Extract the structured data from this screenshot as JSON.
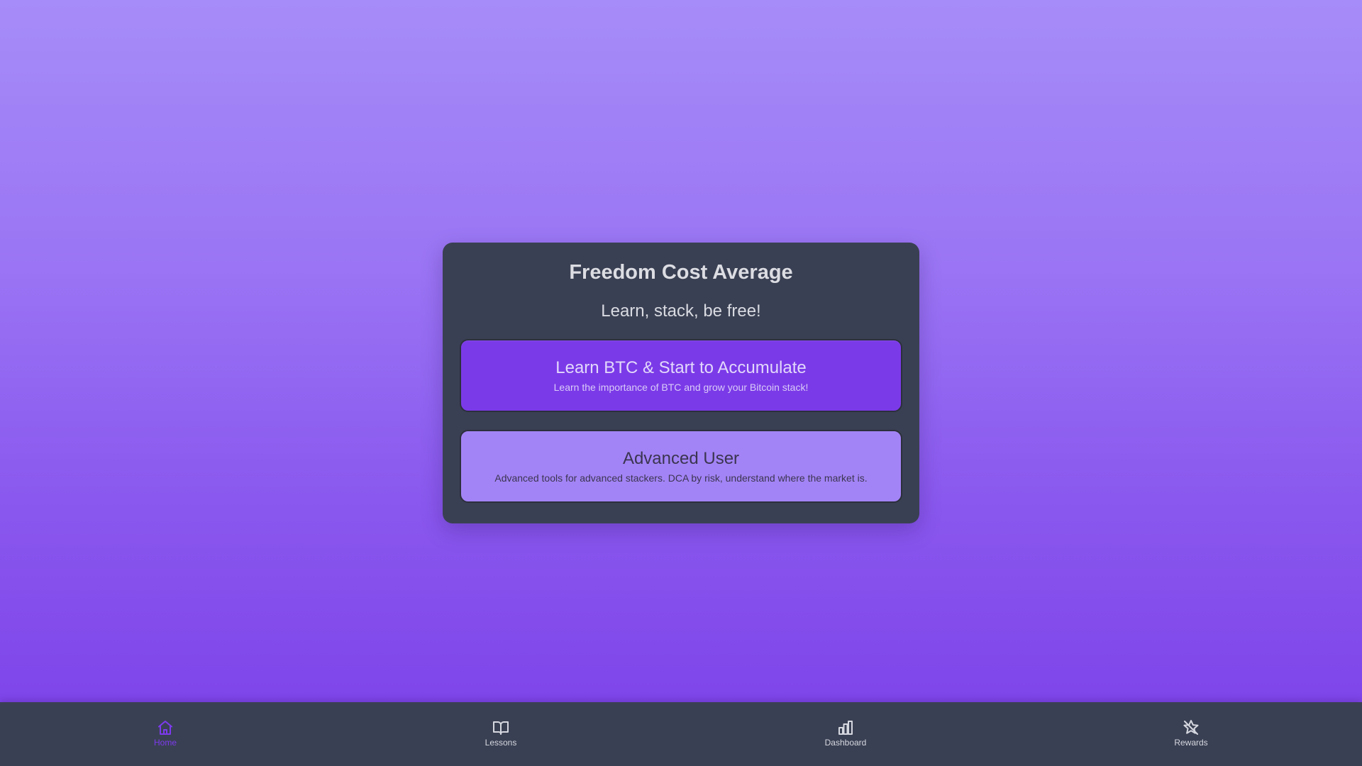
{
  "app": {
    "title": "Freedom Cost Average",
    "tagline": "Learn, stack, be free!"
  },
  "options": [
    {
      "title": "Learn BTC & Start to Accumulate",
      "description": "Learn the importance of BTC and grow your Bitcoin stack!"
    },
    {
      "title": "Advanced User",
      "description": "Advanced tools for advanced stackers. DCA by risk, understand where the market is."
    }
  ],
  "nav": {
    "items": [
      {
        "label": "Home",
        "icon": "home-icon",
        "active": true
      },
      {
        "label": "Lessons",
        "icon": "book-open-icon",
        "active": false
      },
      {
        "label": "Dashboard",
        "icon": "bar-chart-icon",
        "active": false
      },
      {
        "label": "Rewards",
        "icon": "star-off-icon",
        "active": false
      }
    ]
  },
  "colors": {
    "background_top": "#a68cf8",
    "background_bottom": "#7b3fe8",
    "card": "#3a4053",
    "primary_option": "#7b3ae8",
    "secondary_option": "#a384f6",
    "active_nav": "#7c3aed"
  }
}
